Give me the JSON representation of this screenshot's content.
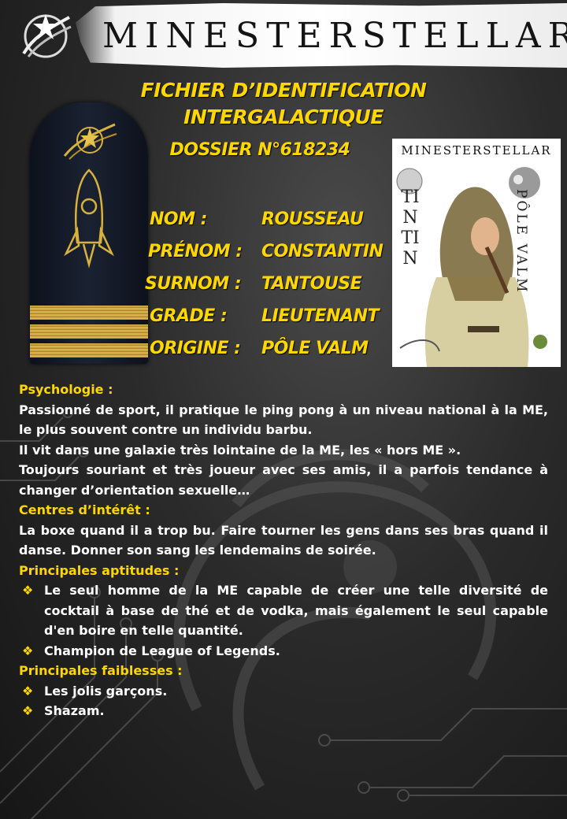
{
  "header": {
    "brand": "MINESTERSTELLAR",
    "logo_icon": "star-comet-logo-icon"
  },
  "file": {
    "title_line1": "FICHIER D’IDENTIFICATION",
    "title_line2": "INTERGALACTIQUE",
    "dossier": "DOSSIER N°618234"
  },
  "identity": [
    {
      "key": "NOM :",
      "value": "ROUSSEAU"
    },
    {
      "key": "PRÉNOM :",
      "value": "CONSTANTIN"
    },
    {
      "key": "SURNOM :",
      "value": "TANTOUSE"
    },
    {
      "key": "GRADE :",
      "value": "LIEUTENANT"
    },
    {
      "key": "ORIGINE :",
      "value": "PÔLE VALM"
    }
  ],
  "epaulette": {
    "emblem_icon": "rocket-icon",
    "stripes": 3
  },
  "poster": {
    "brand": "MINESTERSTELLAR",
    "left_text": "TINTIN",
    "right_text": "PÔLE VALM"
  },
  "sections": {
    "psychologie": {
      "title": "Psychologie :",
      "paragraphs": [
        "Passionné de sport, il pratique le ping pong à un niveau national à la ME, le plus souvent contre un individu barbu.",
        "Il vit dans une galaxie très lointaine de la ME, les « hors ME ».",
        "Toujours souriant et très joueur avec ses amis, il a parfois tendance à changer d’orientation sexuelle…"
      ]
    },
    "interets": {
      "title": "Centres d’intérêt :",
      "paragraphs": [
        "La boxe quand il a trop bu. Faire tourner les gens dans ses bras quand il danse. Donner son sang les lendemains de soirée."
      ]
    },
    "aptitudes": {
      "title": "Principales aptitudes :",
      "items": [
        "Le seul homme de la ME capable de créer une telle diversité de cocktail à base de thé et de vodka, mais également le seul capable d'en boire en telle quantité.",
        "Champion de League of Legends."
      ]
    },
    "faiblesses": {
      "title": "Principales faiblesses :",
      "items": [
        "Les jolis garçons.",
        "Shazam."
      ]
    }
  },
  "bullet_glyph": "❖",
  "colors": {
    "accent": "#ffd700",
    "background": "#2b2b2b",
    "text": "#ffffff"
  }
}
